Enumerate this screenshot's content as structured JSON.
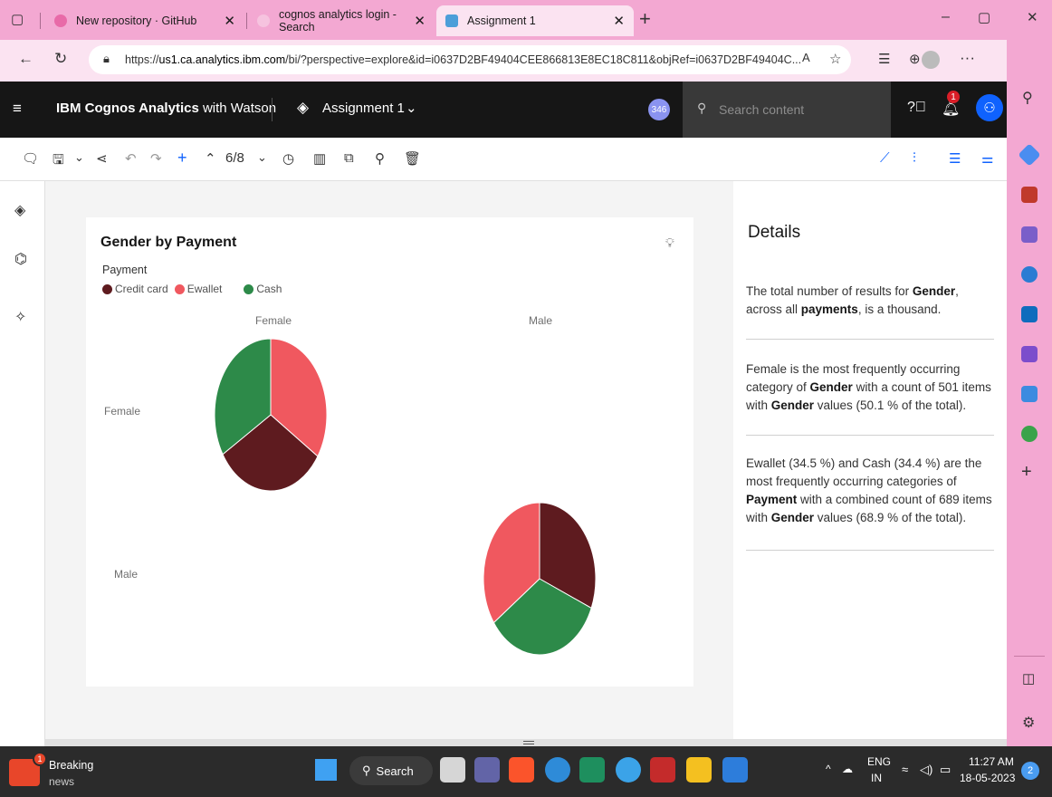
{
  "browser": {
    "tabs": [
      {
        "label": "New repository · GitHub"
      },
      {
        "label": "cognos analytics login - Search"
      },
      {
        "label": "Assignment 1"
      }
    ],
    "url_prefix": "https://",
    "url_host": "us1.ca.analytics.ibm.com",
    "url_rest": "/bi/?perspective=explore&id=i0637D2BF49404CEE866813E8EC18C811&objRef=i0637D2BF49404C..."
  },
  "app": {
    "title_bold": "IBM Cognos Analytics",
    "title_rest": " with Watson",
    "asset_name": "Assignment 1",
    "search_placeholder": "Search content",
    "notification_count": "1",
    "badge_346": "346",
    "page_indicator": "6/8"
  },
  "chart": {
    "title": "Gender by Payment",
    "legend_title": "Payment",
    "col_labels": [
      "Female",
      "Male"
    ],
    "row_labels": [
      "Female",
      "Male"
    ]
  },
  "chart_data": {
    "type": "pie",
    "title": "Gender by Payment",
    "legend": [
      {
        "name": "Credit card",
        "color": "#5e1b1f"
      },
      {
        "name": "Ewallet",
        "color": "#f0585f"
      },
      {
        "name": "Cash",
        "color": "#2d8a49"
      }
    ],
    "pies": [
      {
        "row": "Female",
        "col": "Female",
        "values": [
          {
            "name": "Ewallet",
            "value": 34.2
          },
          {
            "name": "Credit card",
            "value": 32.1
          },
          {
            "name": "Cash",
            "value": 33.7
          }
        ]
      },
      {
        "row": "Male",
        "col": "Male",
        "values": [
          {
            "name": "Credit card",
            "value": 31.3
          },
          {
            "name": "Cash",
            "value": 33.9
          },
          {
            "name": "Ewallet",
            "value": 34.8
          }
        ]
      }
    ]
  },
  "details": {
    "heading": "Details",
    "p1_a": "The total number of results for ",
    "p1_b": "Gender",
    "p1_c": ", across all ",
    "p1_d": "payments",
    "p1_e": ", is a thousand.",
    "p2_a": "Female is the most frequently occurring category of ",
    "p2_b": "Gender",
    "p2_c": " with a count of 501 items with ",
    "p2_d": "Gender",
    "p2_e": " values (50.1 % of the total).",
    "p3_a": "Ewallet (34.5 %) and Cash (34.4 %) are the most frequently occurring categories of ",
    "p3_b": "Payment",
    "p3_c": " with a combined count of 689 items with ",
    "p3_d": "Gender",
    "p3_e": " values (68.9 % of the total)."
  },
  "taskbar": {
    "news_label_1": "Breaking",
    "news_label_2": "news",
    "search_label": "Search",
    "lang_1": "ENG",
    "lang_2": "IN",
    "time": "11:27 AM",
    "date": "18-05-2023",
    "notif_count": "2"
  }
}
